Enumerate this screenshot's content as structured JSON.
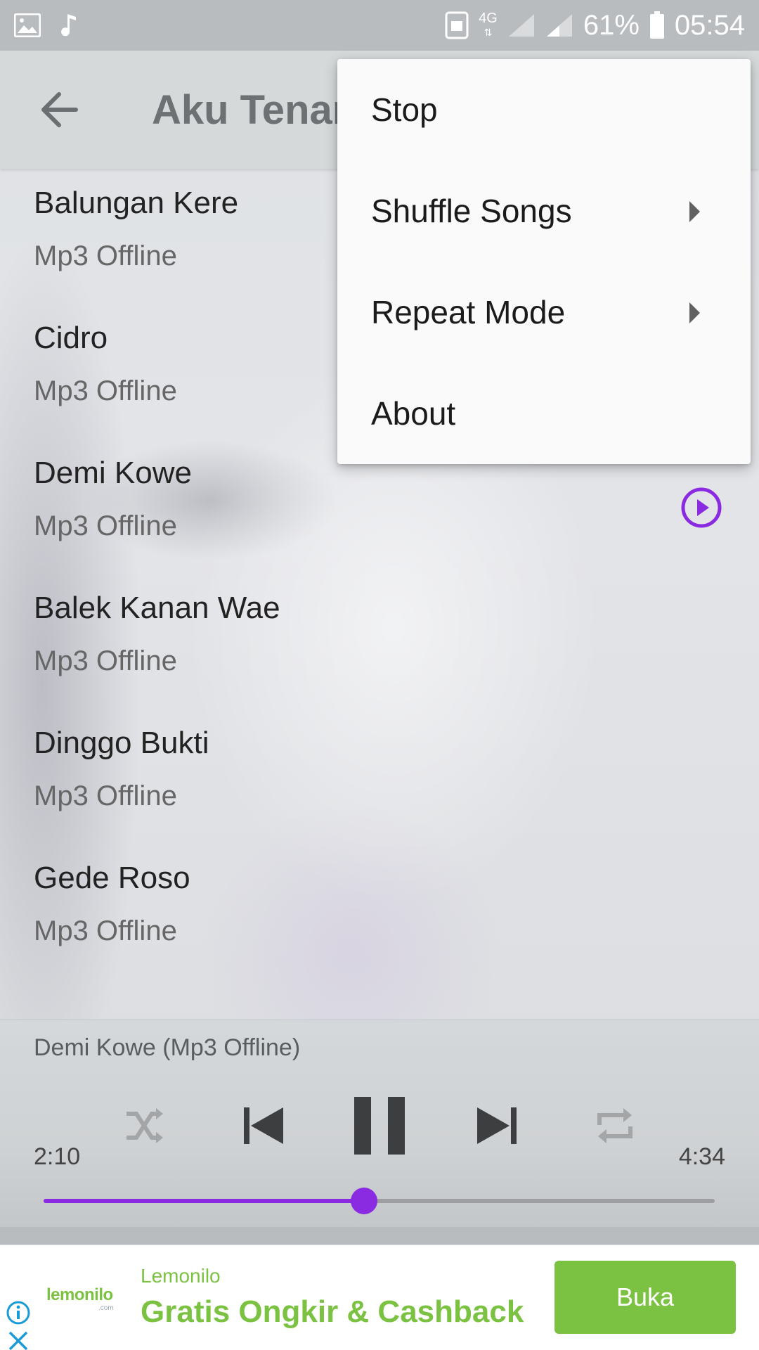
{
  "status_bar": {
    "battery": "61%",
    "time": "05:54",
    "network": "4G",
    "left_icons": [
      "image-icon",
      "music-note-icon"
    ],
    "right_icons": [
      "nfc-icon",
      "4g-icon",
      "signal-icon",
      "signal-icon",
      "battery-icon"
    ]
  },
  "app_bar": {
    "title": "Aku Tenang",
    "back_icon": "arrow-left-icon"
  },
  "songs": [
    {
      "title": "Balungan Kere",
      "subtitle": "Mp3 Offline",
      "playing": false
    },
    {
      "title": "Cidro",
      "subtitle": "Mp3 Offline",
      "playing": false
    },
    {
      "title": "Demi Kowe",
      "subtitle": "Mp3 Offline",
      "playing": true
    },
    {
      "title": "Balek Kanan Wae",
      "subtitle": "Mp3 Offline",
      "playing": false
    },
    {
      "title": "Dinggo Bukti",
      "subtitle": "Mp3 Offline",
      "playing": false
    },
    {
      "title": "Gede Roso",
      "subtitle": "Mp3 Offline",
      "playing": false
    }
  ],
  "player": {
    "now_playing": "Demi Kowe (Mp3 Offline)",
    "elapsed": "2:10",
    "duration": "4:34",
    "progress": 0.477,
    "controls": [
      "shuffle-icon",
      "skip-previous-icon",
      "pause-icon",
      "skip-next-icon",
      "repeat-icon"
    ],
    "accent_color": "#8a2be2"
  },
  "menu": {
    "items": [
      {
        "label": "Stop",
        "has_submenu": false
      },
      {
        "label": "Shuffle Songs",
        "has_submenu": true
      },
      {
        "label": "Repeat Mode",
        "has_submenu": true
      },
      {
        "label": "About",
        "has_submenu": false
      }
    ]
  },
  "ad": {
    "logo_text": "lemonilo",
    "logo_sub": ".com",
    "brand": "Lemonilo",
    "headline": "Gratis Ongkir & Cashback",
    "cta": "Buka",
    "brand_color": "#7cc242"
  }
}
